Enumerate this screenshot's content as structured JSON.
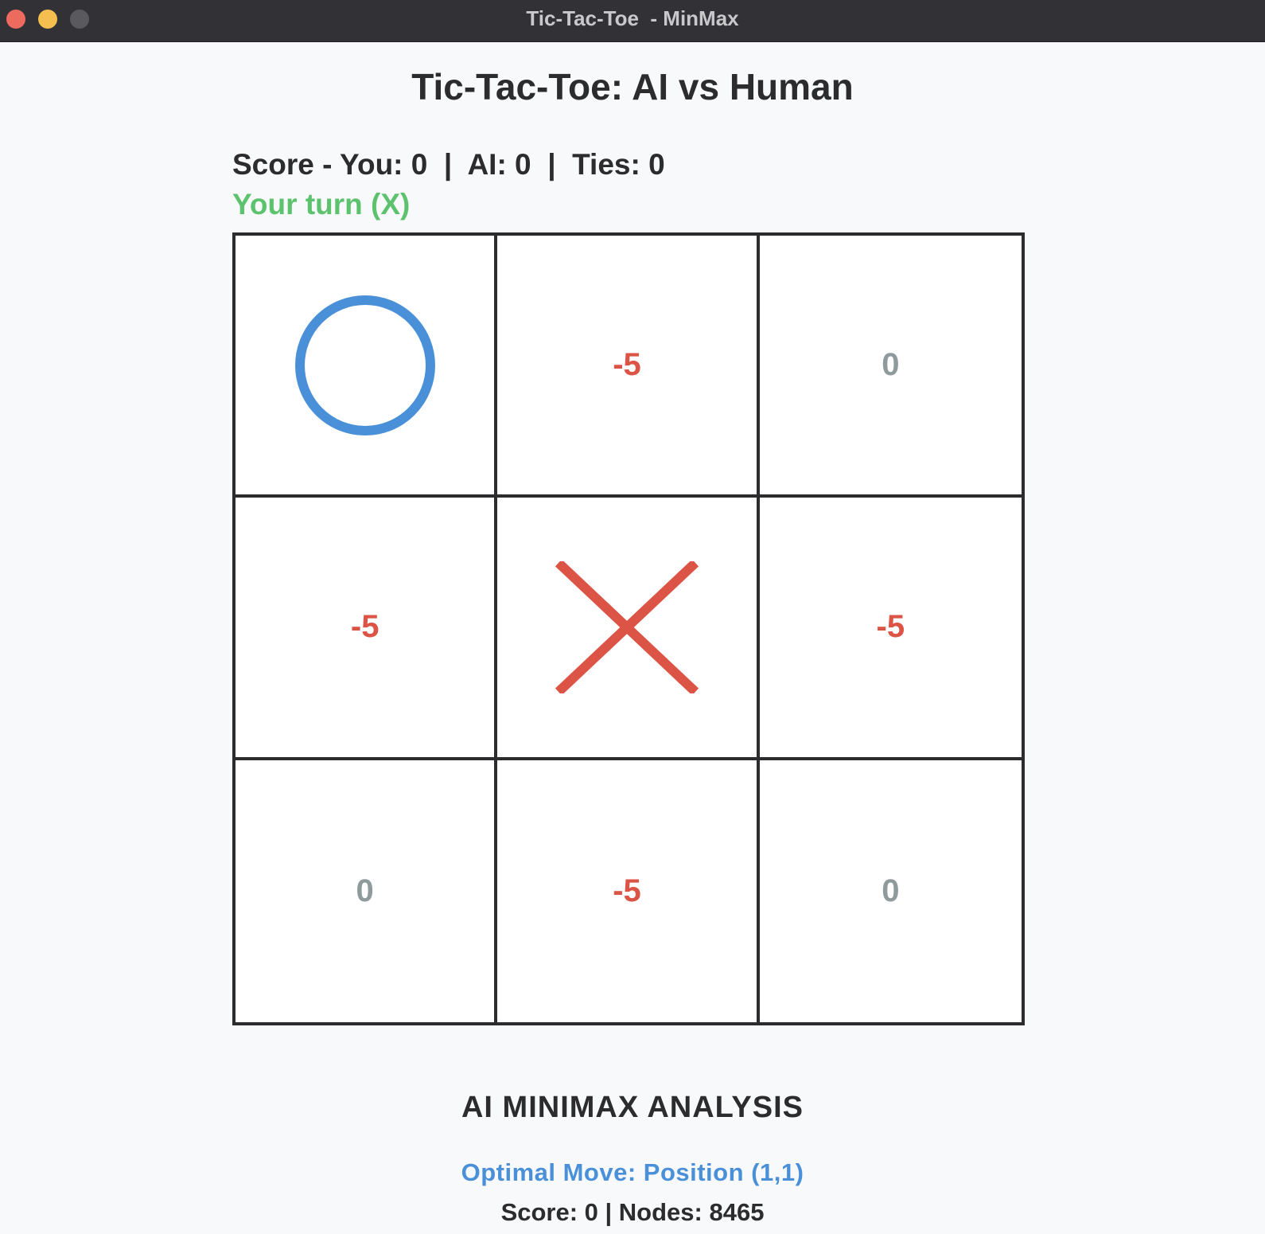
{
  "window": {
    "title": "Tic-Tac-Toe  - MinMax"
  },
  "header": {
    "title": "Tic-Tac-Toe: AI vs Human"
  },
  "status": {
    "score_line": "Score - You: 0  |  AI: 0  |  Ties: 0",
    "turn": "Your turn (X)"
  },
  "colors": {
    "o_mark": "#4a90d9",
    "x_mark": "#dc5445",
    "negative_score": "#dc5445",
    "neutral_score": "#8e9a9b",
    "turn_text": "#5cc26e",
    "optimal_text": "#4a90d9"
  },
  "board": {
    "cells": [
      {
        "mark": "O",
        "score": ""
      },
      {
        "mark": "",
        "score": "-5"
      },
      {
        "mark": "",
        "score": "0"
      },
      {
        "mark": "",
        "score": "-5"
      },
      {
        "mark": "X",
        "score": ""
      },
      {
        "mark": "",
        "score": "-5"
      },
      {
        "mark": "",
        "score": "0"
      },
      {
        "mark": "",
        "score": "-5"
      },
      {
        "mark": "",
        "score": "0"
      }
    ]
  },
  "analysis": {
    "title": "AI MINIMAX ANALYSIS",
    "optimal_move": "Optimal Move: Position (1,1)",
    "stats": "Score: 0 | Nodes: 8465"
  }
}
